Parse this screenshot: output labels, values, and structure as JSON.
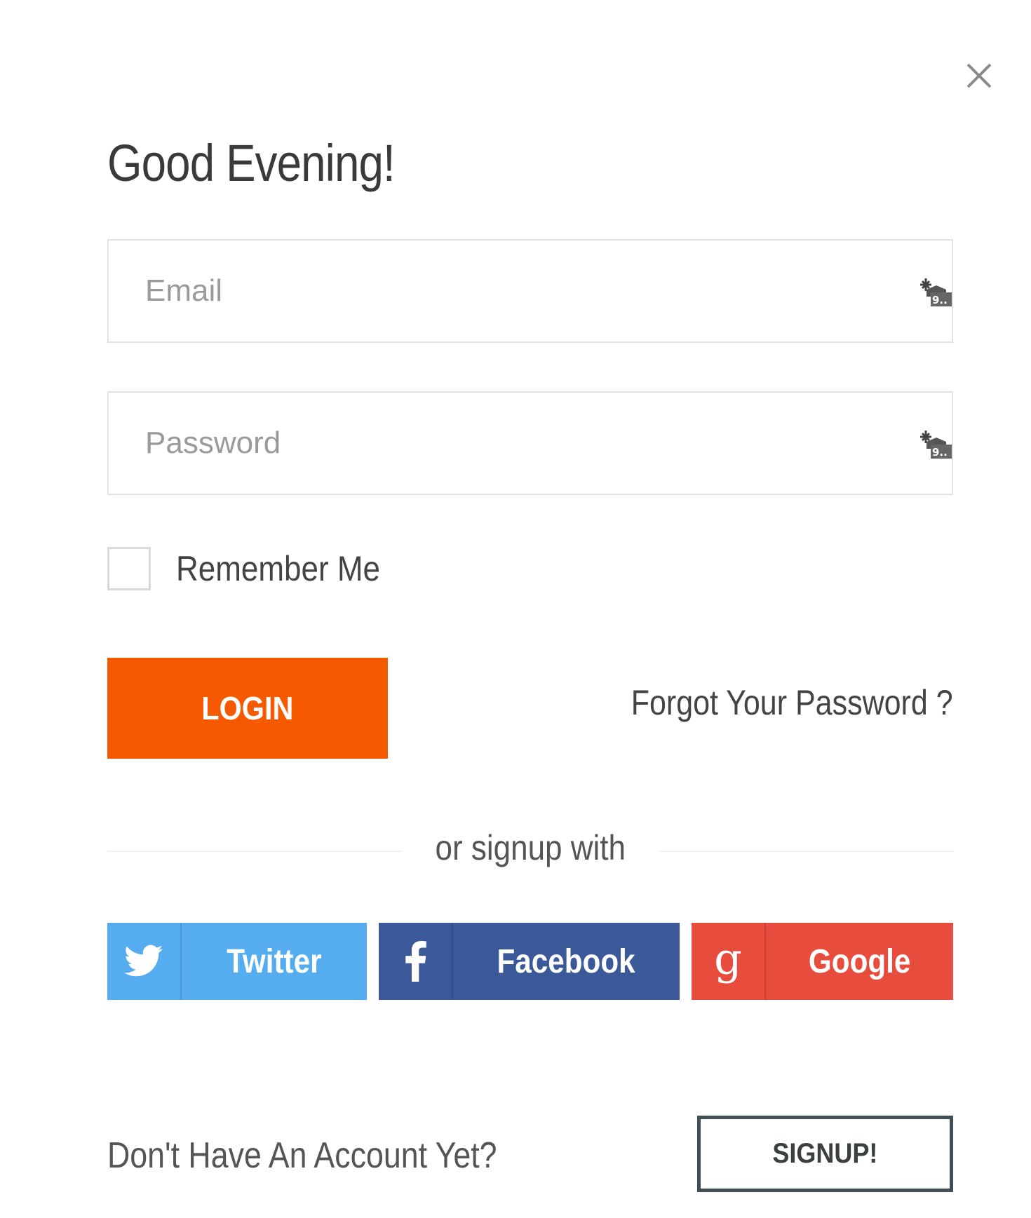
{
  "modal": {
    "title": "Good Evening!",
    "close_icon": "close-icon"
  },
  "form": {
    "email": {
      "placeholder": "Email",
      "value": "",
      "icon": "key-icon"
    },
    "password": {
      "placeholder": "Password",
      "value": "",
      "icon": "key-icon"
    },
    "remember_label": "Remember Me",
    "remember_checked": false,
    "login_label": "LOGIN",
    "forgot_label": "Forgot Your Password ?"
  },
  "divider": {
    "text": "or signup with"
  },
  "social": {
    "twitter": {
      "label": "Twitter",
      "icon": "twitter-icon",
      "color": "#55acee"
    },
    "facebook": {
      "label": "Facebook",
      "icon": "facebook-icon",
      "color": "#3b5998"
    },
    "google": {
      "label": "Google",
      "icon": "google-icon",
      "color": "#e74c3c"
    }
  },
  "footer": {
    "prompt": "Don't Have An Account Yet?",
    "signup_label": "SIGNUP!"
  },
  "colors": {
    "accent": "#f55a00",
    "title_text": "#3a3a3a",
    "border": "#e2e2e2",
    "signup_border": "#3f4f53"
  }
}
